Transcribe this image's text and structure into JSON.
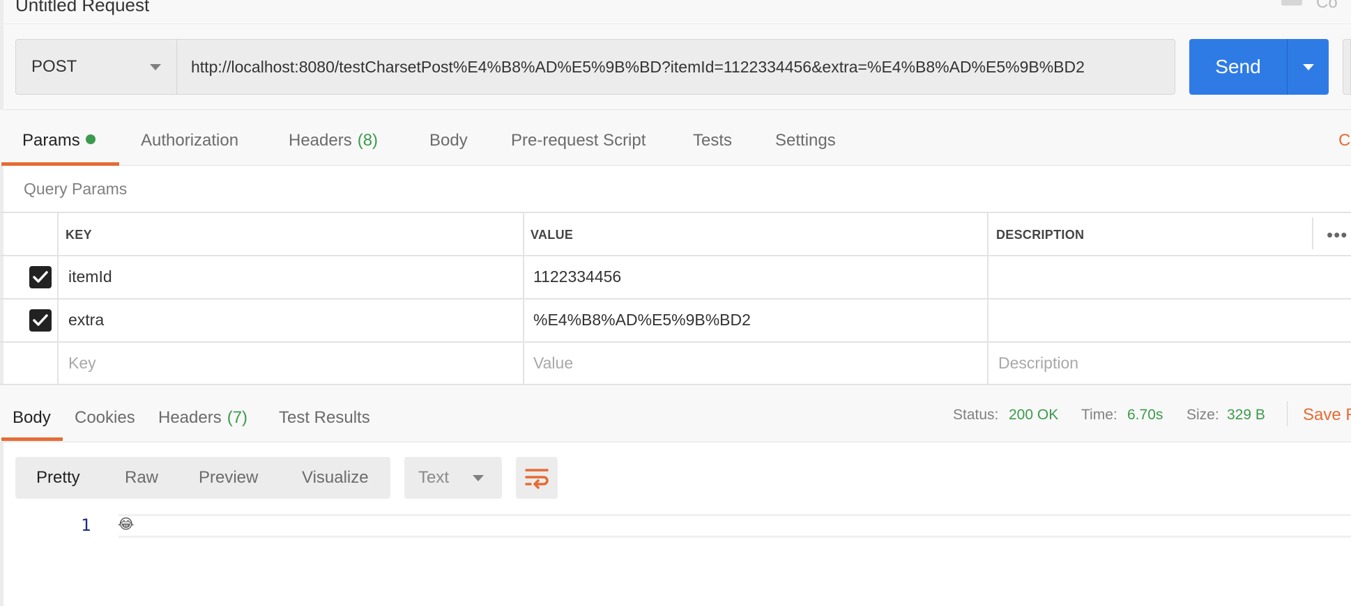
{
  "request": {
    "title": "Untitled Request",
    "top_right_label": "Co",
    "method": "POST",
    "url": "http://localhost:8080/testCharsetPost%E4%B8%AD%E5%9B%BD?itemId=1122334456&extra=%E4%B8%AD%E5%9B%BD2",
    "send_label": "Send"
  },
  "request_tabs": {
    "params": "Params",
    "authorization": "Authorization",
    "headers": "Headers",
    "headers_count": "(8)",
    "body": "Body",
    "prerequest": "Pre-request Script",
    "tests": "Tests",
    "settings": "Settings",
    "cookies_stub": "Co"
  },
  "query_params": {
    "label": "Query Params",
    "columns": [
      "KEY",
      "VALUE",
      "DESCRIPTION"
    ],
    "more": "•••",
    "rows": [
      {
        "key": "itemId",
        "value": "1122334456",
        "description": "",
        "checked": true
      },
      {
        "key": "extra",
        "value": "%E4%B8%AD%E5%9B%BD2",
        "description": "",
        "checked": true
      }
    ],
    "placeholders": {
      "key": "Key",
      "value": "Value",
      "description": "Description"
    }
  },
  "response": {
    "tabs": {
      "body": "Body",
      "cookies": "Cookies",
      "headers": "Headers",
      "headers_count": "(7)",
      "test_results": "Test Results"
    },
    "status_label": "Status:",
    "status_value": "200 OK",
    "time_label": "Time:",
    "time_value": "6.70s",
    "size_label": "Size:",
    "size_value": "329 B",
    "save_label": "Save R",
    "view_modes": [
      "Pretty",
      "Raw",
      "Preview",
      "Visualize"
    ],
    "active_view": "Pretty",
    "format": "Text",
    "code_lines": [
      {
        "number": "1",
        "content": "😂"
      }
    ]
  },
  "colors": {
    "accent_orange": "#e56b33",
    "send_blue": "#2f7be6",
    "success_green": "#3c9a4c"
  }
}
